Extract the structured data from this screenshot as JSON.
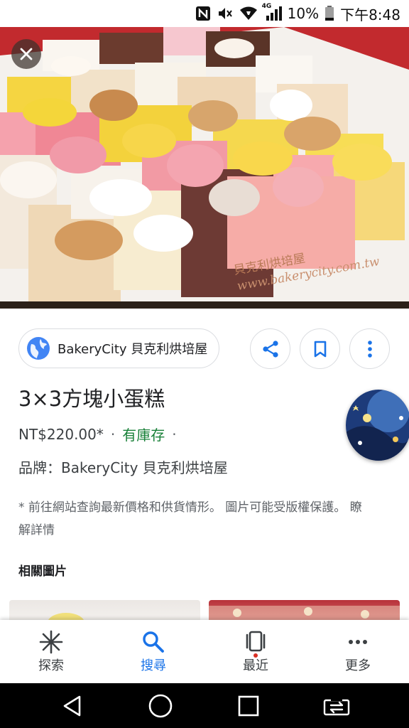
{
  "status_bar": {
    "nfc_icon": "nfc-icon",
    "mute_icon": "mute-icon",
    "wifi_icon": "wifi-icon",
    "network_type": "4G",
    "battery_percent": "10%",
    "time": "下午8:48"
  },
  "hero": {
    "watermark_name": "貝克利烘培屋",
    "watermark_url": "www.bakerycity.com.tw"
  },
  "source": {
    "name": "BakeryCity 貝克利烘培屋"
  },
  "product": {
    "title": "3×3方塊小蛋糕",
    "price": "NT$220.00*",
    "separator": "·",
    "stock": "有庫存",
    "brand": "品牌：BakeryCity 貝克利烘培屋",
    "note": "* 前往網站查詢最新價格和供貨情形。 圖片可能受版權保護。 瞭解詳情"
  },
  "related": {
    "title": "相關圖片"
  },
  "bottom_nav": {
    "items": [
      {
        "label": "探索",
        "icon": "asterisk-icon"
      },
      {
        "label": "搜尋",
        "icon": "search-icon"
      },
      {
        "label": "最近",
        "icon": "recent-cards-icon"
      },
      {
        "label": "更多",
        "icon": "more-horizontal-icon"
      }
    ],
    "active": "搜尋"
  },
  "colors": {
    "accent": "#1a73e8",
    "stock_green": "#188038",
    "hero_red": "#b51c24"
  }
}
